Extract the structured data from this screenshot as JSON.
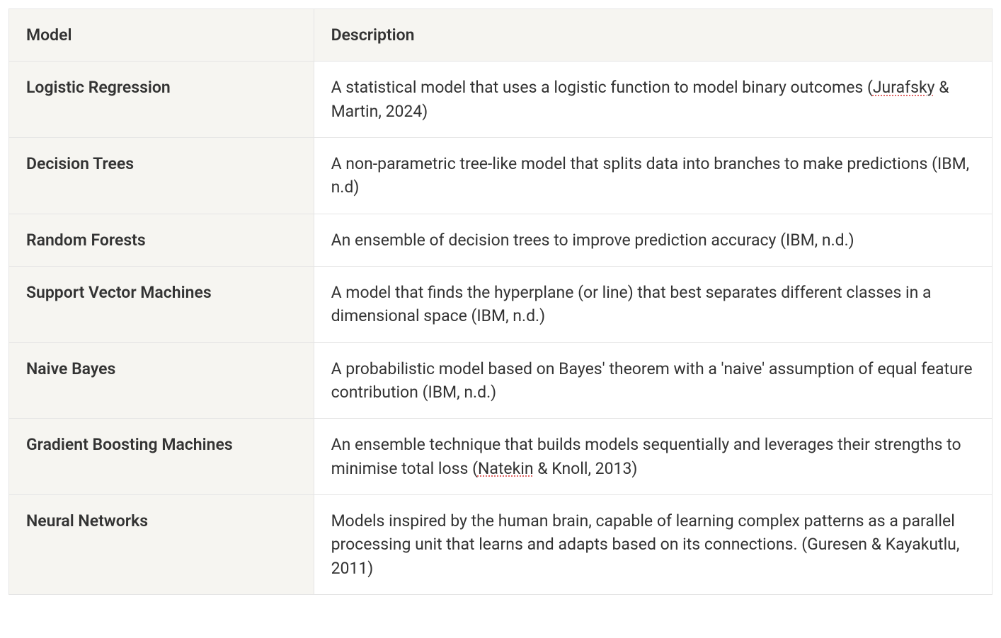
{
  "table": {
    "headers": {
      "model": "Model",
      "description": "Description"
    },
    "rows": [
      {
        "model": "Logistic Regression",
        "desc_pre": "A statistical model that uses a logistic function to model binary outcomes (",
        "desc_spell": "Jurafsky",
        "desc_post": " & Martin, 2024)"
      },
      {
        "model": "Decision Trees",
        "desc_pre": "A non-parametric tree-like model that splits data into branches to make predictions (IBM, n.d)",
        "desc_spell": "",
        "desc_post": ""
      },
      {
        "model": "Random Forests",
        "desc_pre": "An ensemble of decision trees to improve prediction accuracy (IBM, n.d.)",
        "desc_spell": "",
        "desc_post": ""
      },
      {
        "model": "Support Vector Machines",
        "desc_pre": "A model that finds the hyperplane (or line) that best separates different classes in a dimensional space (IBM, n.d.)",
        "desc_spell": "",
        "desc_post": ""
      },
      {
        "model": "Naive Bayes",
        "desc_pre": "A probabilistic model based on Bayes' theorem with a 'naive' assumption of equal feature contribution (IBM, n.d.)",
        "desc_spell": "",
        "desc_post": ""
      },
      {
        "model": "Gradient Boosting Machines",
        "desc_pre": "An ensemble technique that builds models sequentially and leverages their strengths to minimise total loss (",
        "desc_spell": "Natekin",
        "desc_post": " & Knoll, 2013)"
      },
      {
        "model": "Neural Networks",
        "desc_pre": "Models inspired by the human brain, capable of learning complex patterns as a parallel processing unit that learns and adapts based on its connections. (Guresen & Kayakutlu, 2011)",
        "desc_spell": "",
        "desc_post": ""
      }
    ]
  }
}
